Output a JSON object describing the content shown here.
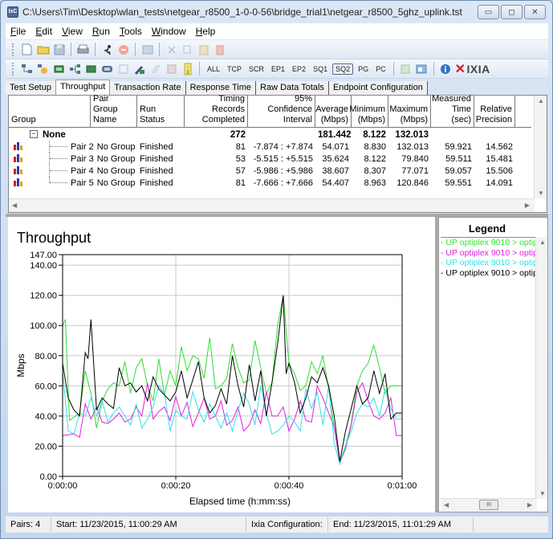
{
  "window": {
    "title": "C:\\Users\\Tim\\Desktop\\wlan_tests\\netgear_r8500_1-0-0-56\\bridge_trial1\\netgear_r8500_5ghz_uplink.tst",
    "app_icon_label": "IxC",
    "buttons": {
      "minimize": "▭",
      "maximize": "◻",
      "close": "✕"
    }
  },
  "menu": [
    {
      "label": "File",
      "accel": "F"
    },
    {
      "label": "Edit",
      "accel": "E"
    },
    {
      "label": "View",
      "accel": "V"
    },
    {
      "label": "Run",
      "accel": "R"
    },
    {
      "label": "Tools",
      "accel": "T"
    },
    {
      "label": "Window",
      "accel": "W"
    },
    {
      "label": "Help",
      "accel": "H"
    }
  ],
  "toolbar1": {
    "icons": [
      "new-file-icon",
      "open-folder-icon",
      "save-icon",
      "print-icon",
      "run-icon",
      "stop-icon",
      "report-icon",
      "cut-icon",
      "copy-icon",
      "paste-icon",
      "delete-icon"
    ]
  },
  "toolbar2": {
    "filters": [
      "ALL",
      "TCP",
      "SCR",
      "EP1",
      "EP2",
      "SQ1",
      "SQ2",
      "PG",
      "PC"
    ],
    "active_filter": "SQ2",
    "brand": "IXIA"
  },
  "tabs": [
    {
      "label": "Test Setup",
      "active": false
    },
    {
      "label": "Throughput",
      "active": true
    },
    {
      "label": "Transaction Rate",
      "active": false
    },
    {
      "label": "Response Time",
      "active": false
    },
    {
      "label": "Raw Data Totals",
      "active": false
    },
    {
      "label": "Endpoint Configuration",
      "active": false
    }
  ],
  "grid": {
    "columns": [
      {
        "label": "Group"
      },
      {
        "label": "Pair Group Name"
      },
      {
        "label": "Run Status"
      },
      {
        "label": "Timing Records Completed"
      },
      {
        "label": "95% Confidence Interval"
      },
      {
        "label": "Average (Mbps)"
      },
      {
        "label": "Minimum (Mbps)"
      },
      {
        "label": "Maximum (Mbps)"
      },
      {
        "label": "Measured Time (sec)"
      },
      {
        "label": "Relative Precision"
      }
    ],
    "group_row": {
      "expander": "−",
      "name": "None",
      "records": "272",
      "average": "181.442",
      "minimum": "8.122",
      "maximum": "132.013"
    },
    "rows": [
      {
        "pair": "Pair 2",
        "group_name": "No Group",
        "status": "Finished",
        "records": "81",
        "ci": "-7.874 : +7.874",
        "average": "54.071",
        "minimum": "8.830",
        "maximum": "132.013",
        "time": "59.921",
        "precision": "14.562"
      },
      {
        "pair": "Pair 3",
        "group_name": "No Group",
        "status": "Finished",
        "records": "53",
        "ci": "-5.515 : +5.515",
        "average": "35.624",
        "minimum": "8.122",
        "maximum": "79.840",
        "time": "59.511",
        "precision": "15.481"
      },
      {
        "pair": "Pair 4",
        "group_name": "No Group",
        "status": "Finished",
        "records": "57",
        "ci": "-5.986 : +5.986",
        "average": "38.607",
        "minimum": "8.307",
        "maximum": "77.071",
        "time": "59.057",
        "precision": "15.506"
      },
      {
        "pair": "Pair 5",
        "group_name": "No Group",
        "status": "Finished",
        "records": "81",
        "ci": "-7.666 : +7.666",
        "average": "54.407",
        "minimum": "8.963",
        "maximum": "120.846",
        "time": "59.551",
        "precision": "14.091"
      }
    ]
  },
  "legend": {
    "title": "Legend",
    "items": [
      {
        "label": "- UP optiplex 9010 > optip",
        "color": "#33dd33"
      },
      {
        "label": "- UP optiplex 9010 > optip",
        "color": "#e020e0"
      },
      {
        "label": "- UP optiplex 9010 > optip",
        "color": "#33e0e8"
      },
      {
        "label": "- UP optiplex 9010 > optip",
        "color": "#000000"
      }
    ]
  },
  "statusbar": {
    "pairs": "Pairs: 4",
    "start": "Start: 11/23/2015, 11:00:29 AM",
    "ixia_config": "Ixia Configuration:",
    "end": "End: 11/23/2015, 11:01:29 AM"
  },
  "scroll": {
    "thumb": "III"
  },
  "chart_data": {
    "type": "line",
    "title": "Throughput",
    "xlabel": "Elapsed time (h:mm:ss)",
    "ylabel": "Mbps",
    "xlim": [
      0,
      60
    ],
    "ylim": [
      0,
      147
    ],
    "x_ticks": [
      0,
      20,
      40,
      60
    ],
    "x_tick_labels": [
      "0:00:00",
      "0:00:20",
      "0:00:40",
      "0:01:00"
    ],
    "y_ticks": [
      0,
      20,
      40,
      60,
      80,
      100,
      120,
      140,
      147
    ],
    "y_tick_labels": [
      "0.00",
      "20.00",
      "40.00",
      "60.00",
      "80.00",
      "100.00",
      "120.00",
      "140.00",
      "147.00"
    ],
    "grid": true,
    "legend_position": "right-pane",
    "series": [
      {
        "name": "UP optiplex 9010 > optip (green)",
        "color": "#33dd33",
        "points": [
          [
            0,
            100
          ],
          [
            0.5,
            104
          ],
          [
            1.2,
            37
          ],
          [
            3,
            42
          ],
          [
            4,
            70
          ],
          [
            5,
            55
          ],
          [
            6,
            32
          ],
          [
            7,
            50
          ],
          [
            8,
            58
          ],
          [
            9,
            62
          ],
          [
            10,
            60
          ],
          [
            11,
            76
          ],
          [
            12,
            55
          ],
          [
            13,
            72
          ],
          [
            14,
            78
          ],
          [
            15,
            60
          ],
          [
            16,
            50
          ],
          [
            17,
            78
          ],
          [
            18,
            54
          ],
          [
            19,
            70
          ],
          [
            20,
            60
          ],
          [
            21,
            86
          ],
          [
            22,
            70
          ],
          [
            23,
            80
          ],
          [
            24,
            78
          ],
          [
            25,
            65
          ],
          [
            26,
            92
          ],
          [
            27,
            58
          ],
          [
            28,
            60
          ],
          [
            29,
            65
          ],
          [
            30,
            88
          ],
          [
            31,
            72
          ],
          [
            32,
            62
          ],
          [
            33,
            64
          ],
          [
            34,
            90
          ],
          [
            35,
            72
          ],
          [
            36,
            55
          ],
          [
            37,
            62
          ],
          [
            38,
            100
          ],
          [
            39,
            120
          ],
          [
            40,
            75
          ],
          [
            41,
            68
          ],
          [
            42,
            57
          ],
          [
            43,
            60
          ],
          [
            44,
            76
          ],
          [
            45,
            68
          ],
          [
            46,
            80
          ],
          [
            47,
            58
          ],
          [
            48,
            32
          ],
          [
            49,
            10
          ],
          [
            50,
            20
          ],
          [
            51,
            35
          ],
          [
            52,
            60
          ],
          [
            53,
            70
          ],
          [
            54,
            75
          ],
          [
            55,
            87
          ],
          [
            56,
            72
          ],
          [
            57,
            55
          ],
          [
            58,
            60
          ],
          [
            59,
            60
          ],
          [
            60,
            60
          ]
        ]
      },
      {
        "name": "UP optiplex 9010 > optip (magenta)",
        "color": "#e020e0",
        "points": [
          [
            0,
            27
          ],
          [
            2,
            28
          ],
          [
            3,
            26
          ],
          [
            4,
            48
          ],
          [
            5,
            38
          ],
          [
            6,
            46
          ],
          [
            7,
            36
          ],
          [
            8,
            35
          ],
          [
            9,
            38
          ],
          [
            10,
            42
          ],
          [
            11,
            36
          ],
          [
            12,
            38
          ],
          [
            13,
            46
          ],
          [
            14,
            40
          ],
          [
            15,
            62
          ],
          [
            16,
            38
          ],
          [
            17,
            43
          ],
          [
            18,
            46
          ],
          [
            19,
            37
          ],
          [
            20,
            53
          ],
          [
            21,
            40
          ],
          [
            22,
            49
          ],
          [
            23,
            33
          ],
          [
            24,
            42
          ],
          [
            25,
            52
          ],
          [
            26,
            38
          ],
          [
            27,
            40
          ],
          [
            28,
            50
          ],
          [
            29,
            34
          ],
          [
            30,
            37
          ],
          [
            31,
            46
          ],
          [
            32,
            30
          ],
          [
            33,
            34
          ],
          [
            34,
            44
          ],
          [
            35,
            35
          ],
          [
            36,
            56
          ],
          [
            37,
            40
          ],
          [
            38,
            40
          ],
          [
            39,
            46
          ],
          [
            40,
            30
          ],
          [
            41,
            38
          ],
          [
            42,
            50
          ],
          [
            43,
            37
          ],
          [
            44,
            36
          ],
          [
            45,
            60
          ],
          [
            46,
            52
          ],
          [
            47,
            42
          ],
          [
            48,
            33
          ],
          [
            49,
            9
          ],
          [
            50,
            18
          ],
          [
            51,
            34
          ],
          [
            52,
            56
          ],
          [
            53,
            62
          ],
          [
            54,
            50
          ],
          [
            55,
            40
          ],
          [
            56,
            38
          ],
          [
            57,
            42
          ],
          [
            58,
            52
          ],
          [
            59,
            27
          ],
          [
            60,
            27
          ]
        ]
      },
      {
        "name": "UP optiplex 9010 > optip (cyan)",
        "color": "#33e0e8",
        "points": [
          [
            0,
            70
          ],
          [
            1,
            30
          ],
          [
            2,
            28
          ],
          [
            3,
            42
          ],
          [
            4,
            40
          ],
          [
            5,
            52
          ],
          [
            6,
            40
          ],
          [
            7,
            50
          ],
          [
            8,
            36
          ],
          [
            9,
            42
          ],
          [
            10,
            46
          ],
          [
            11,
            40
          ],
          [
            12,
            34
          ],
          [
            13,
            48
          ],
          [
            14,
            32
          ],
          [
            15,
            38
          ],
          [
            16,
            46
          ],
          [
            17,
            60
          ],
          [
            18,
            55
          ],
          [
            19,
            30
          ],
          [
            20,
            44
          ],
          [
            21,
            40
          ],
          [
            22,
            38
          ],
          [
            23,
            56
          ],
          [
            24,
            44
          ],
          [
            25,
            36
          ],
          [
            26,
            48
          ],
          [
            27,
            40
          ],
          [
            28,
            32
          ],
          [
            29,
            42
          ],
          [
            30,
            30
          ],
          [
            31,
            44
          ],
          [
            32,
            55
          ],
          [
            33,
            48
          ],
          [
            34,
            34
          ],
          [
            35,
            60
          ],
          [
            36,
            42
          ],
          [
            37,
            28
          ],
          [
            38,
            30
          ],
          [
            39,
            34
          ],
          [
            40,
            40
          ],
          [
            41,
            36
          ],
          [
            42,
            30
          ],
          [
            43,
            58
          ],
          [
            44,
            45
          ],
          [
            45,
            56
          ],
          [
            46,
            34
          ],
          [
            47,
            60
          ],
          [
            48,
            22
          ],
          [
            49,
            8
          ],
          [
            50,
            20
          ],
          [
            51,
            30
          ],
          [
            52,
            42
          ],
          [
            53,
            48
          ],
          [
            54,
            46
          ],
          [
            55,
            52
          ],
          [
            56,
            40
          ],
          [
            57,
            58
          ],
          [
            58,
            45
          ],
          [
            59,
            38
          ],
          [
            60,
            38
          ]
        ]
      },
      {
        "name": "UP optiplex 9010 > optip (black)",
        "color": "#000000",
        "points": [
          [
            0,
            75
          ],
          [
            1,
            52
          ],
          [
            2,
            44
          ],
          [
            3,
            40
          ],
          [
            4,
            82
          ],
          [
            4.5,
            78
          ],
          [
            5,
            104
          ],
          [
            6,
            44
          ],
          [
            7,
            52
          ],
          [
            8,
            48
          ],
          [
            9,
            45
          ],
          [
            10,
            72
          ],
          [
            11,
            60
          ],
          [
            12,
            62
          ],
          [
            13,
            56
          ],
          [
            14,
            60
          ],
          [
            15,
            50
          ],
          [
            16,
            66
          ],
          [
            17,
            58
          ],
          [
            18,
            54
          ],
          [
            19,
            50
          ],
          [
            20,
            56
          ],
          [
            21,
            70
          ],
          [
            22,
            52
          ],
          [
            23,
            64
          ],
          [
            24,
            76
          ],
          [
            25,
            52
          ],
          [
            26,
            42
          ],
          [
            27,
            47
          ],
          [
            28,
            58
          ],
          [
            29,
            48
          ],
          [
            30,
            80
          ],
          [
            31,
            60
          ],
          [
            32,
            46
          ],
          [
            33,
            74
          ],
          [
            34,
            50
          ],
          [
            35,
            70
          ],
          [
            36,
            40
          ],
          [
            37,
            62
          ],
          [
            38,
            88
          ],
          [
            39,
            120
          ],
          [
            39.5,
            68
          ],
          [
            40,
            75
          ],
          [
            41,
            62
          ],
          [
            42,
            42
          ],
          [
            43,
            52
          ],
          [
            44,
            66
          ],
          [
            45,
            62
          ],
          [
            46,
            72
          ],
          [
            47,
            60
          ],
          [
            48,
            40
          ],
          [
            49,
            10
          ],
          [
            50,
            30
          ],
          [
            51,
            45
          ],
          [
            52,
            60
          ],
          [
            53,
            48
          ],
          [
            54,
            52
          ],
          [
            55,
            70
          ],
          [
            56,
            55
          ],
          [
            57,
            68
          ],
          [
            58,
            38
          ],
          [
            59,
            42
          ],
          [
            60,
            42
          ]
        ]
      }
    ]
  }
}
